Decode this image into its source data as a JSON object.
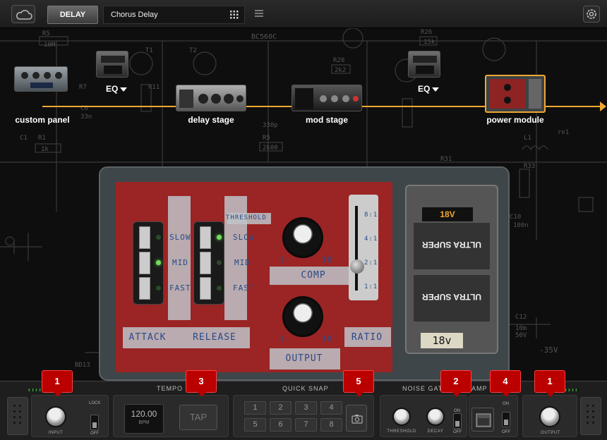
{
  "topbar": {
    "module": "DELAY",
    "preset_name": "Chorus Delay"
  },
  "chain": {
    "nodes": [
      {
        "label": "custom panel"
      },
      {
        "label": "delay stage"
      },
      {
        "label": "mod stage"
      },
      {
        "label": "power module"
      }
    ],
    "eq_labels": [
      "EQ",
      "EQ"
    ],
    "accent_color": "#f0a832"
  },
  "pedal": {
    "threshold": "THRESHOLD",
    "attack": "ATTACK",
    "release": "RELEASE",
    "comp": "COMP",
    "output": "OUTPUT",
    "ratio": "RATIO",
    "speed": [
      "SLOW",
      "MID",
      "FAST"
    ],
    "ratio_marks": [
      "8:1",
      "4:1",
      "2:1",
      "1:1"
    ],
    "knob_min": "1",
    "knob_max": "10",
    "battery_voltage": "18V",
    "battery_tag": "18v",
    "battery_brand": "ULTRA SUPER",
    "schematic_texts": {
      "part_top": "BC560C",
      "part_bottom": "BD13",
      "voltage": "-35V"
    }
  },
  "bottom": {
    "tempo_title": "TEMPO",
    "quick_snap_title": "QUICK SNAP",
    "noise_gate_title": "NOISE GATE",
    "amp_title": "AMP",
    "input_label": "INPUT",
    "output_label": "OUTPUT",
    "lock_label": "LOCK",
    "off_label": "OFF",
    "on_label": "ON",
    "bpm_value": "120.00",
    "bpm_unit": "BPM",
    "tap_label": "TAP",
    "snaps": [
      "1",
      "2",
      "3",
      "4",
      "5",
      "6",
      "7",
      "8"
    ],
    "threshold_label": "THRESHOLD",
    "decay_label": "DECAY",
    "badges": [
      "1",
      "3",
      "5",
      "2",
      "4",
      "1"
    ]
  }
}
